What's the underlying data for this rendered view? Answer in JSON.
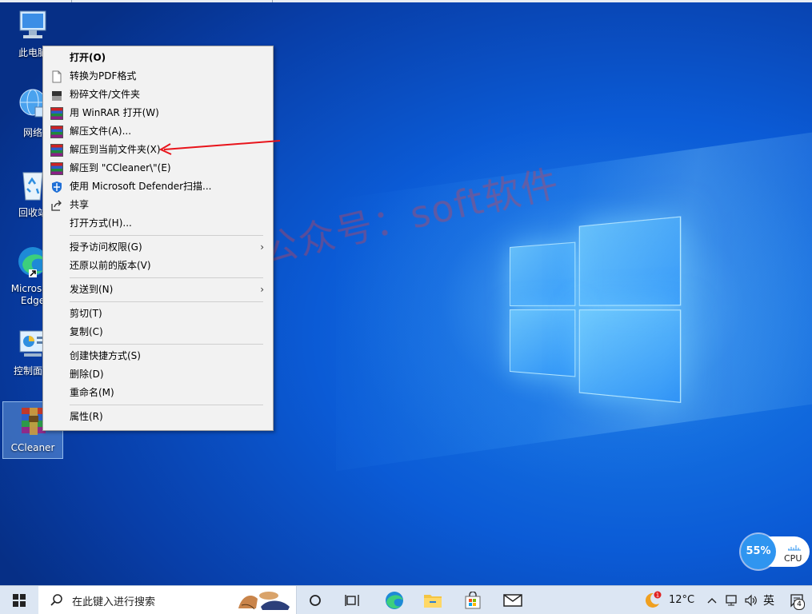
{
  "desktop": {
    "icons": [
      {
        "label": "此电脑",
        "icon": "computer-icon"
      },
      {
        "label": "网络",
        "icon": "network-icon"
      },
      {
        "label": "回收站",
        "icon": "recycle-bin-icon"
      },
      {
        "label": "Microsoft Edge",
        "icon": "edge-icon"
      },
      {
        "label": "控制面板",
        "icon": "control-panel-icon"
      },
      {
        "label": "CCleaner",
        "icon": "winrar-archive-icon"
      }
    ],
    "watermark": "微信公众号：soft软件"
  },
  "context_menu": {
    "items": [
      {
        "label": "打开(O)",
        "icon": "",
        "bold": true
      },
      {
        "label": "转换为PDF格式",
        "icon": "pdf-doc-icon"
      },
      {
        "label": "粉碎文件/文件夹",
        "icon": "shredder-icon"
      },
      {
        "label": "用 WinRAR 打开(W)",
        "icon": "winrar-icon"
      },
      {
        "label": "解压文件(A)...",
        "icon": "winrar-icon"
      },
      {
        "label": "解压到当前文件夹(X)",
        "icon": "winrar-icon"
      },
      {
        "label": "解压到 \"CCleaner\\\"(E)",
        "icon": "winrar-icon"
      },
      {
        "label": "使用 Microsoft Defender扫描...",
        "icon": "defender-shield-icon"
      },
      {
        "label": "共享",
        "icon": "share-icon"
      },
      {
        "label": "打开方式(H)...",
        "icon": ""
      },
      {
        "label": "授予访问权限(G)",
        "icon": "",
        "submenu": true
      },
      {
        "label": "还原以前的版本(V)",
        "icon": ""
      },
      {
        "label": "发送到(N)",
        "icon": "",
        "submenu": true
      },
      {
        "label": "剪切(T)",
        "icon": ""
      },
      {
        "label": "复制(C)",
        "icon": ""
      },
      {
        "label": "创建快捷方式(S)",
        "icon": ""
      },
      {
        "label": "删除(D)",
        "icon": ""
      },
      {
        "label": "重命名(M)",
        "icon": ""
      },
      {
        "label": "属性(R)",
        "icon": ""
      }
    ],
    "submenu_arrow": "›",
    "annotation_arrow_color": "#e8141b"
  },
  "taskbar": {
    "search_placeholder": "在此键入进行搜索",
    "temperature": "12°C",
    "ime": "英",
    "notification_count": "4"
  },
  "cpu_widget": {
    "percent": "55%",
    "label": "CPU"
  }
}
